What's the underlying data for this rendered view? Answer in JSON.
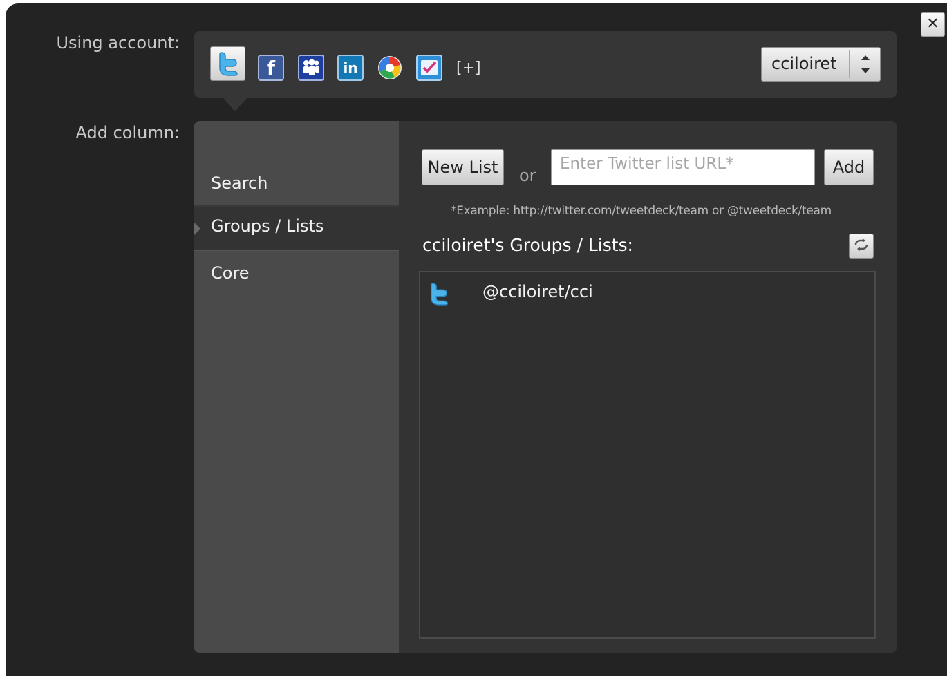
{
  "dialog": {
    "close_label": "✕"
  },
  "account": {
    "label": "Using account:",
    "services": [
      {
        "name": "twitter",
        "icon": "twitter-icon",
        "color": "#5bc0f2",
        "glyph": "t",
        "selected": true
      },
      {
        "name": "facebook",
        "icon": "facebook-icon",
        "color": "#3b5998",
        "glyph": "f"
      },
      {
        "name": "myspace",
        "icon": "myspace-icon",
        "color": "#1e3f9e",
        "glyph": "m"
      },
      {
        "name": "linkedin",
        "icon": "linkedin-icon",
        "color": "#1279b4",
        "glyph": "in"
      },
      {
        "name": "buzz",
        "icon": "buzz-icon",
        "color": "#ffffff",
        "glyph": ""
      },
      {
        "name": "foursquare",
        "icon": "foursquare-icon",
        "color": "#2f8fd6",
        "glyph": "✓"
      }
    ],
    "add_label": "[+]",
    "selected_account": "cciloiret"
  },
  "column": {
    "label": "Add column:",
    "nav": {
      "search": "Search",
      "groups": "Groups / Lists",
      "core": "Core"
    },
    "new_list_label": "New List",
    "or_label": "or",
    "url_placeholder": "Enter Twitter list URL*",
    "add_label": "Add",
    "example": "*Example: http://twitter.com/tweetdeck/team or @tweetdeck/team",
    "lists_heading": "cciloiret's Groups / Lists:",
    "lists": [
      {
        "name": "@cciloiret/cci",
        "icon": "twitter-icon"
      }
    ]
  }
}
